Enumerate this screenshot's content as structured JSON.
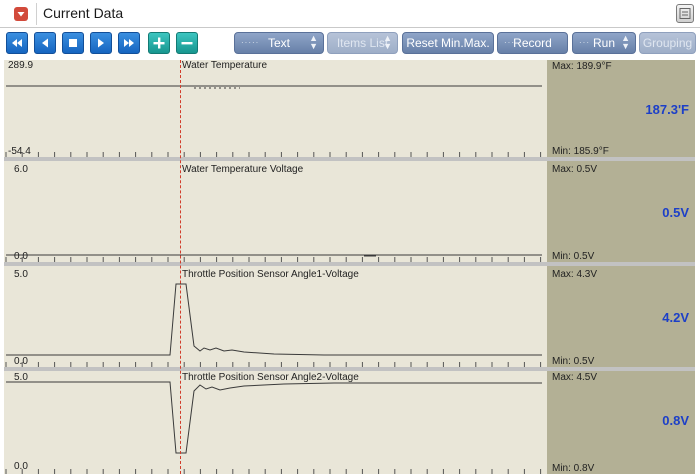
{
  "window": {
    "title": "Current Data"
  },
  "toolbar": {
    "nav_icons": [
      "rewind-icon",
      "step-back-icon",
      "stop-icon",
      "play-icon",
      "fast-forward-icon",
      "add-icon",
      "remove-icon"
    ],
    "text_label": "Text",
    "items_list_label": "Items List",
    "reset_label": "Reset Min.Max.",
    "record_label": "Record",
    "run_label": "Run",
    "grouping_label": "Grouping"
  },
  "colors": {
    "plot_bg": "#e9e6d8",
    "side_bg": "#b3b095",
    "value_text": "#1c3fc8",
    "cursor_line": "#d23c2a",
    "accent_button": "#1565c0"
  },
  "graphs": [
    {
      "name": "Water Temperature",
      "top_label": "289.9",
      "bottom_label": "-54.4",
      "max": "Max: 189.9°F",
      "current": "187.3'F",
      "min": "Min: 185.9°F"
    },
    {
      "name": "Water Temperature Voltage",
      "top_label": "6.0",
      "bottom_label": "0.0",
      "max": "Max:   0.5V",
      "current": "0.5V",
      "min": "Min:   0.5V"
    },
    {
      "name": "Throttle Position Sensor Angle1-Voltage",
      "top_label": "5.0",
      "bottom_label": "0.0",
      "max": "Max:   4.3V",
      "current": "4.2V",
      "min": "Min:   0.5V"
    },
    {
      "name": "Throttle Position Sensor Angle2-Voltage",
      "top_label": "5.0",
      "bottom_label": "0.0",
      "max": "Max:   4.5V",
      "current": "0.8V",
      "min": "Min:   0.8V"
    }
  ]
}
